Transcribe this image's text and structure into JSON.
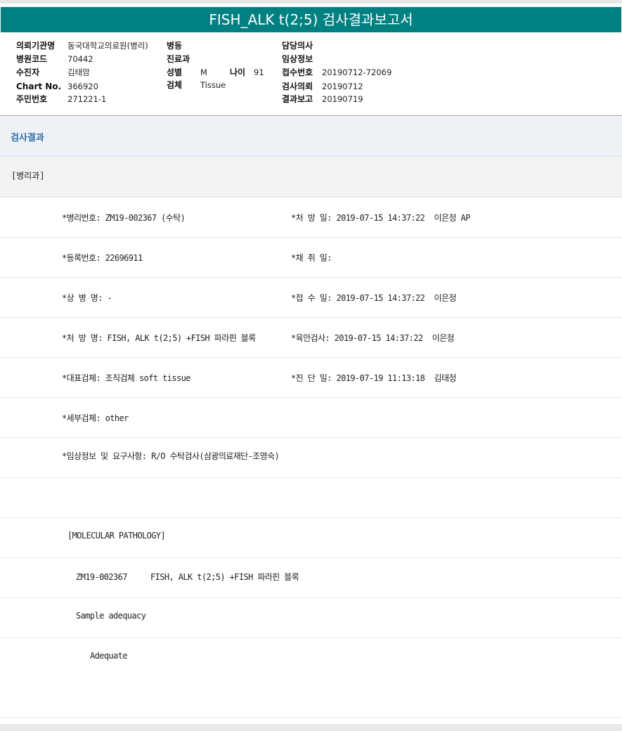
{
  "title": "FISH_ALK t(2;5) 검사결과보고서",
  "header": {
    "labels": {
      "institution": "의뢰기관명",
      "hospital_code": "병원코드",
      "examinee": "수진자",
      "chart_no": "Chart No.",
      "resident_no": "주민번호",
      "ward": "병동",
      "department": "진료과",
      "sex": "성별",
      "age": "나이",
      "specimen": "검체",
      "doctor": "담당의사",
      "clinical_info": "임상정보",
      "receipt_no": "접수번호",
      "request_date": "검사의뢰",
      "report_date": "결과보고"
    },
    "values": {
      "institution": "동국대학교의료원(병리)",
      "hospital_code": "70442",
      "examinee": "김태암",
      "chart_no": "366920",
      "resident_no": "271221-1",
      "sex": "M",
      "age": "91",
      "specimen": "Tissue",
      "receipt_no": "20190712-72069",
      "request_date": "20190712",
      "report_date": "20190719"
    }
  },
  "section_title": "검사결과",
  "dept": "[병리과]",
  "rows": [
    {
      "left": "*병리번호: ZM19-002367 (수탁)",
      "right": "*처 방 일: 2019-07-15 14:37:22  이은정 AP"
    },
    {
      "left": "*등록번호: 22696911",
      "right": "*채 취 일:"
    },
    {
      "left": "*상 병 명: -",
      "right": "*접 수 일: 2019-07-15 14:37:22  이은정"
    },
    {
      "left": "*처 방 명: FISH, ALK t(2;5) +FISH 파라핀 블록",
      "right": "*육안검사: 2019-07-15 14:37:22  이은정"
    },
    {
      "left": "*대표검체: 조직검체 soft tissue",
      "right": "*진 단 일: 2019-07-19 11:13:18  김태정"
    },
    {
      "left": "*세부검체: other",
      "right": ""
    },
    {
      "left": "*임상정보 및 요구사항: R/O 수탁검사(삼광의료재단-조영숙)",
      "right": ""
    },
    {
      "left": "",
      "right": ""
    },
    {
      "left": "[MOLECULAR PATHOLOGY]",
      "right": ""
    },
    {
      "left": "ZM19-002367     FISH, ALK t(2;5) +FISH 파라핀 블록",
      "right": ""
    },
    {
      "left": "Sample adequacy",
      "right": ""
    },
    {
      "left": "Adequate",
      "right": ""
    },
    {
      "left": "",
      "right": ""
    }
  ]
}
